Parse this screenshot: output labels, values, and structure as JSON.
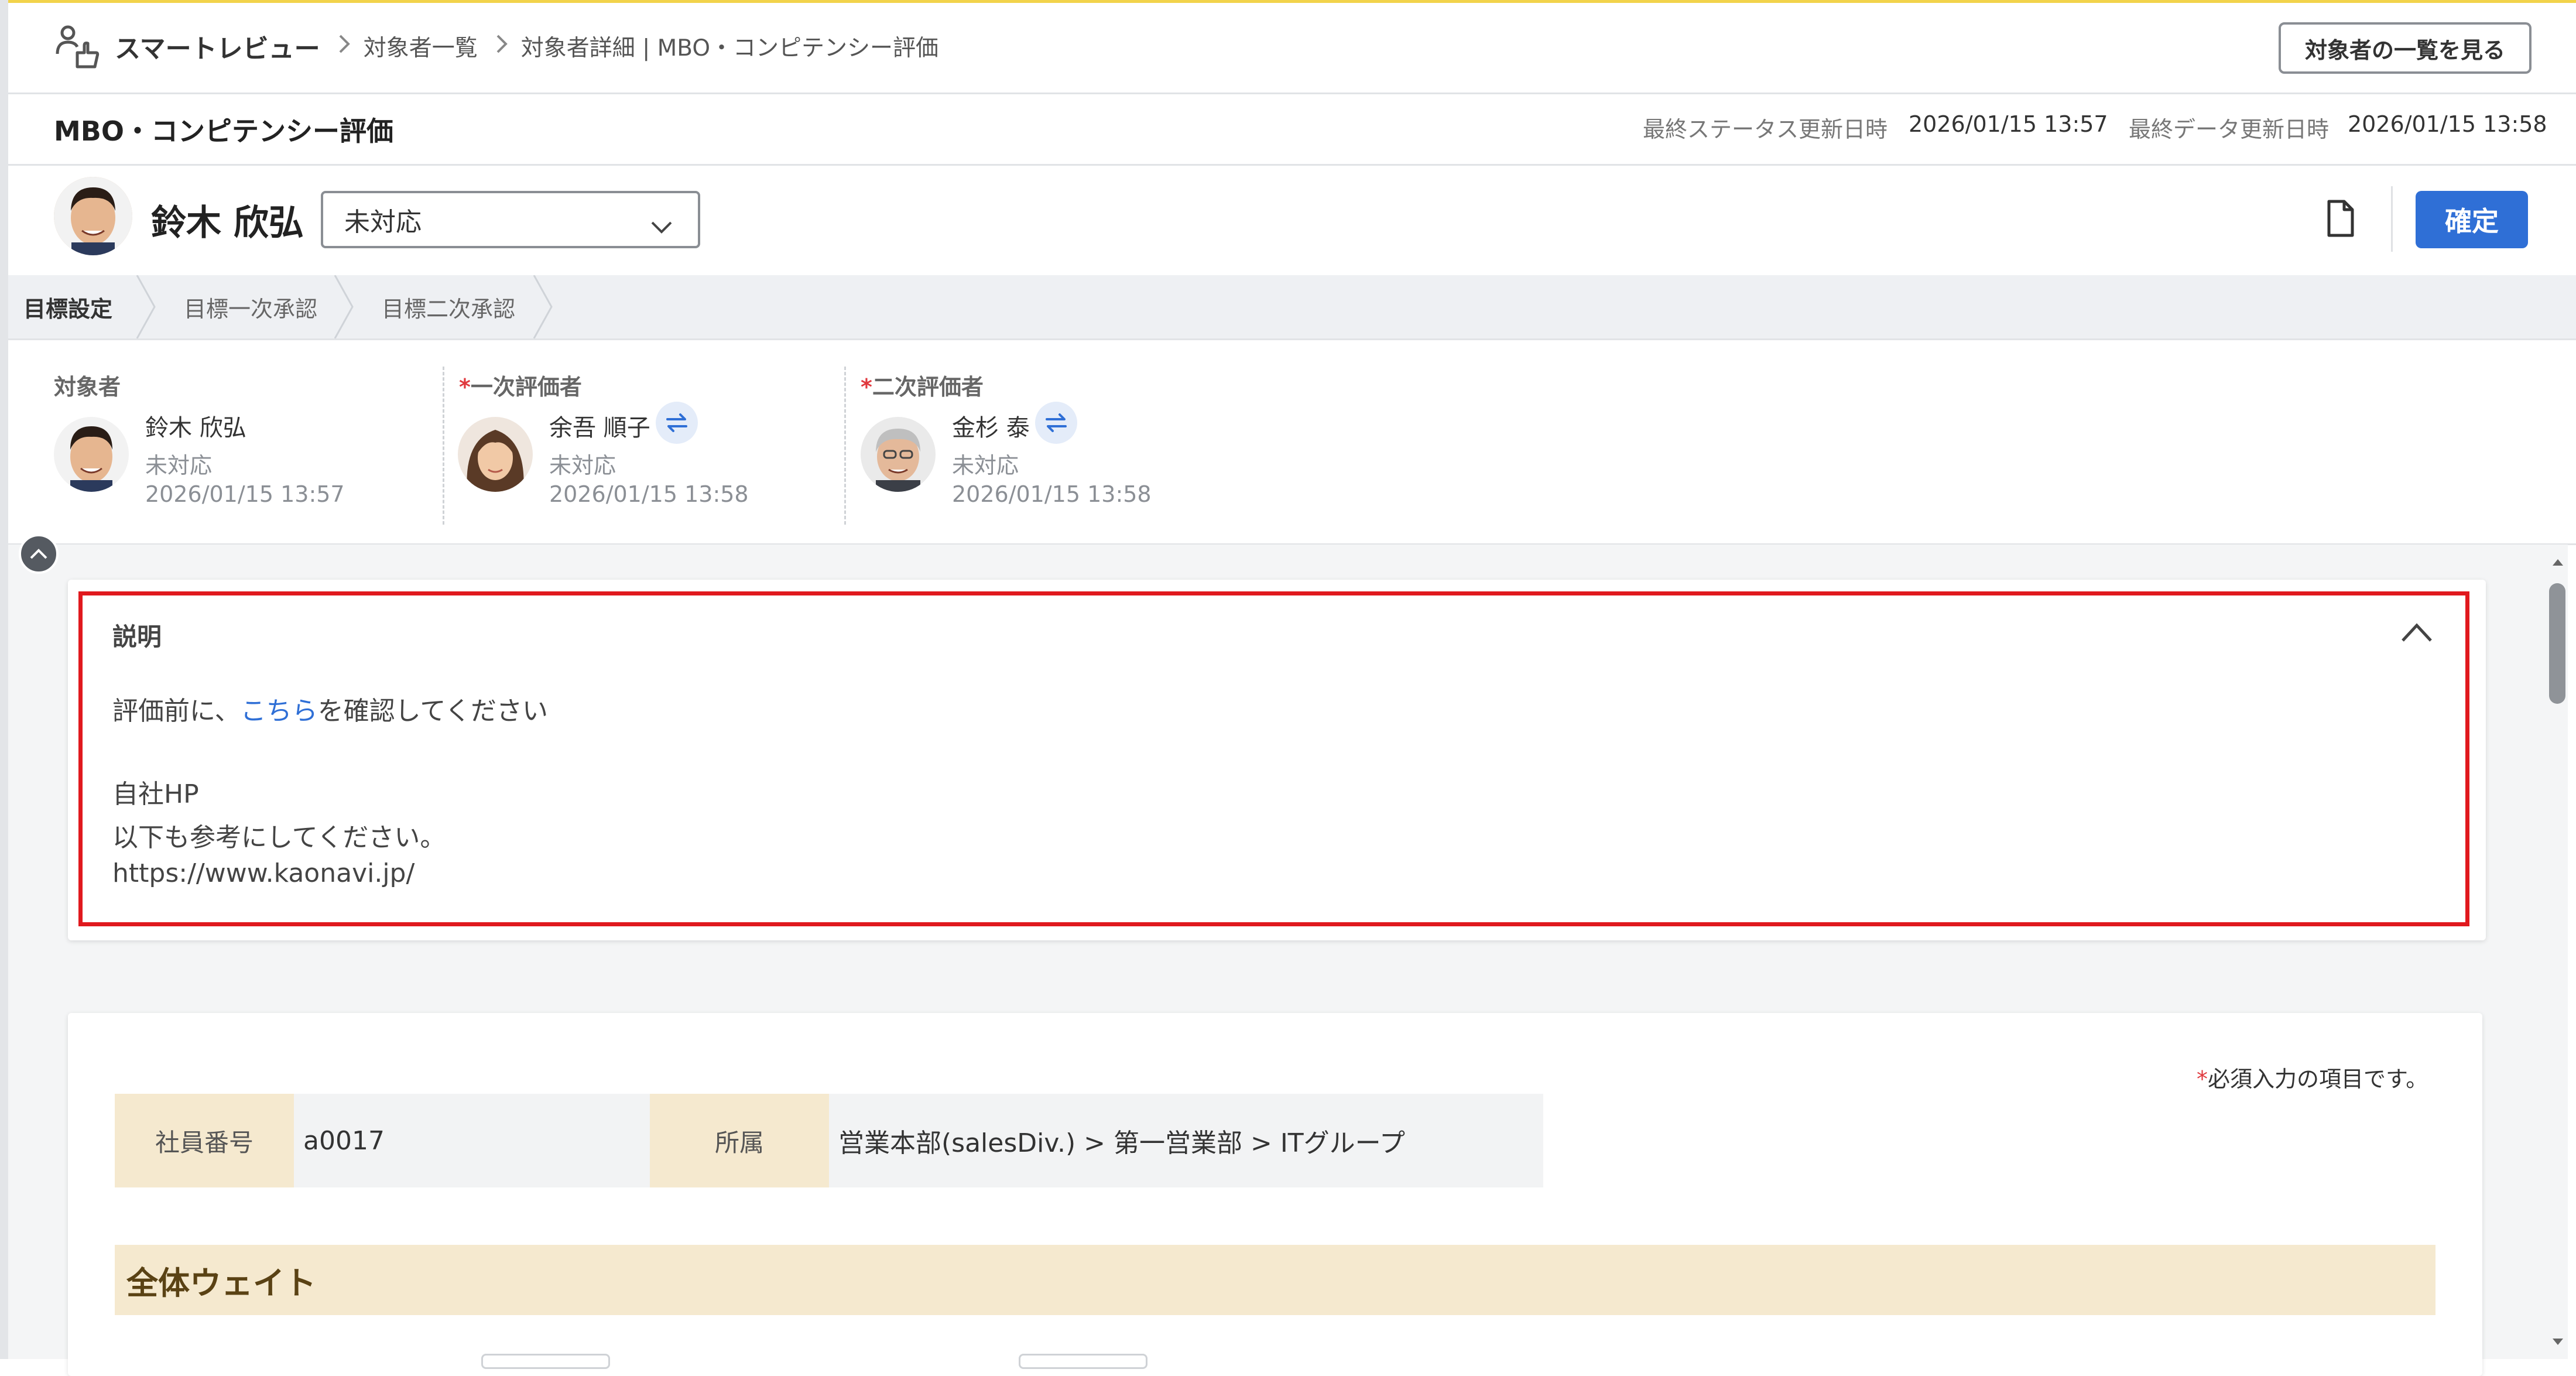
{
  "header": {
    "app_name": "スマートレビュー",
    "breadcrumb_1": "対象者一覧",
    "breadcrumb_2": "対象者詳細 | MBO・コンピテンシー評価",
    "list_button": "対象者の一覧を見る"
  },
  "subheader": {
    "title": "MBO・コンピテンシー評価",
    "status_label": "最終ステータス更新日時",
    "status_value": "2026/01/15 13:57",
    "data_label": "最終データ更新日時",
    "data_value": "2026/01/15 13:58"
  },
  "person": {
    "name": "鈴木 欣弘",
    "status_select": "未対応",
    "confirm_button": "確定"
  },
  "tabs": [
    "目標設定",
    "目標一次承認",
    "目標二次承認"
  ],
  "evaluators": [
    {
      "label": "対象者",
      "required": false,
      "name": "鈴木 欣弘",
      "status": "未対応",
      "date": "2026/01/15 13:57"
    },
    {
      "label": "一次評価者",
      "required": true,
      "name": "余吾 順子",
      "status": "未対応",
      "date": "2026/01/15 13:58"
    },
    {
      "label": "二次評価者",
      "required": true,
      "name": "金杉 泰",
      "status": "未対応",
      "date": "2026/01/15 13:58"
    }
  ],
  "description": {
    "heading": "説明",
    "line1_prefix": "評価前に、",
    "line1_link": "こちら",
    "line1_suffix": "を確認してください",
    "link2": "自社HP",
    "line3": "以下も参考にしてください。",
    "url": "https://www.kaonavi.jp/"
  },
  "form": {
    "required_note": "必須入力の項目です。",
    "required_mark": "*",
    "employee_no_label": "社員番号",
    "employee_no_value": "a0017",
    "affiliation_label": "所属",
    "affiliation_value": "営業本部(salesDiv.) > 第一営業部 > ITグループ",
    "section_title": "全体ウェイト"
  },
  "colors": {
    "accent": "#2f6fd6",
    "highlight_border": "#e0191e",
    "table_header": "#f5e9cf"
  }
}
